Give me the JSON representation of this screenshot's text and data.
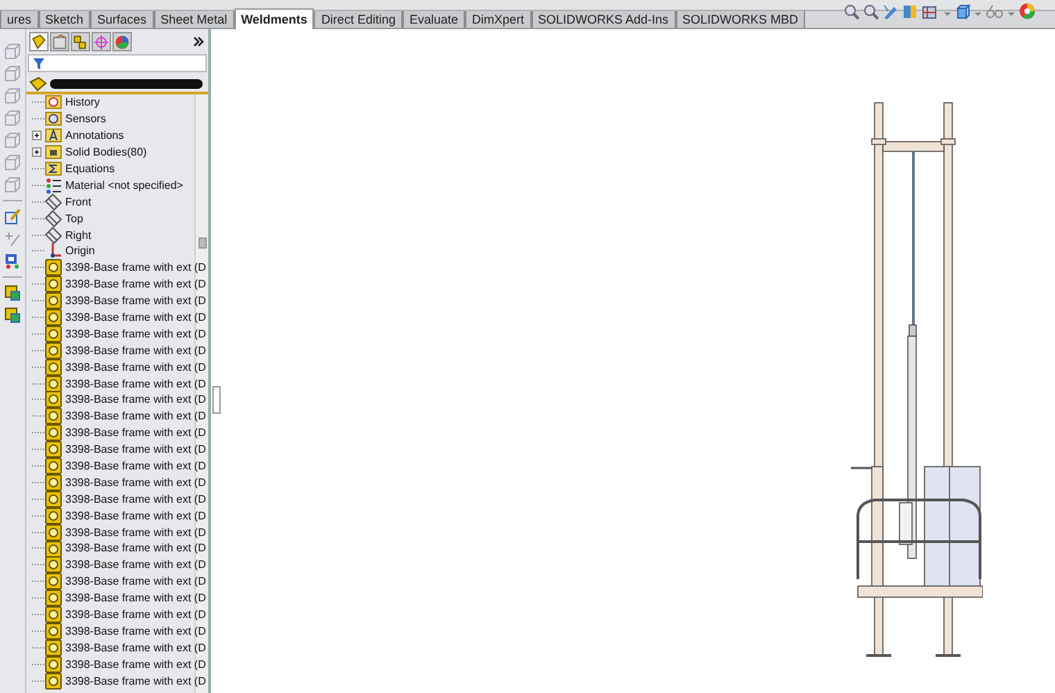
{
  "tabs": [
    {
      "label": "ures",
      "selected": false
    },
    {
      "label": "Sketch",
      "selected": false
    },
    {
      "label": "Surfaces",
      "selected": false
    },
    {
      "label": "Sheet Metal",
      "selected": false
    },
    {
      "label": "Weldments",
      "selected": true
    },
    {
      "label": "Direct Editing",
      "selected": false
    },
    {
      "label": "Evaluate",
      "selected": false
    },
    {
      "label": "DimXpert",
      "selected": false
    },
    {
      "label": "SOLIDWORKS Add-Ins",
      "selected": false
    },
    {
      "label": "SOLIDWORKS MBD",
      "selected": false
    }
  ],
  "panel_tabs": [
    {
      "kind": "tree",
      "selected": true
    },
    {
      "kind": "property",
      "selected": false
    },
    {
      "kind": "config",
      "selected": false
    },
    {
      "kind": "dim",
      "selected": false
    },
    {
      "kind": "display",
      "selected": false
    }
  ],
  "tree": {
    "items": [
      {
        "kind": "history",
        "label": "History",
        "expandable": false
      },
      {
        "kind": "sensors",
        "label": "Sensors",
        "expandable": false
      },
      {
        "kind": "annotations",
        "label": "Annotations",
        "expandable": true
      },
      {
        "kind": "bodies",
        "label": "Solid Bodies(80)",
        "expandable": true
      },
      {
        "kind": "equations",
        "label": "Equations",
        "expandable": false
      },
      {
        "kind": "material",
        "label": "Material <not specified>",
        "expandable": false
      },
      {
        "kind": "plane",
        "label": "Front",
        "expandable": false
      },
      {
        "kind": "plane",
        "label": "Top",
        "expandable": false
      },
      {
        "kind": "plane",
        "label": "Right",
        "expandable": false
      },
      {
        "kind": "origin",
        "label": "Origin",
        "expandable": false
      },
      {
        "kind": "part",
        "label": "3398-Base frame with ext (D",
        "expandable": false
      },
      {
        "kind": "part",
        "label": "3398-Base frame with ext (D",
        "expandable": false
      },
      {
        "kind": "part",
        "label": "3398-Base frame with ext (D",
        "expandable": false
      },
      {
        "kind": "part",
        "label": "3398-Base frame with ext (D",
        "expandable": false
      },
      {
        "kind": "part",
        "label": "3398-Base frame with ext (D",
        "expandable": false
      },
      {
        "kind": "part",
        "label": "3398-Base frame with ext (D",
        "expandable": false
      },
      {
        "kind": "part",
        "label": "3398-Base frame with ext (D",
        "expandable": false
      },
      {
        "kind": "part",
        "label": "3398-Base frame with ext (D",
        "expandable": false
      },
      {
        "kind": "part",
        "label": "3398-Base frame with ext (D",
        "expandable": false
      },
      {
        "kind": "part",
        "label": "3398-Base frame with ext (D",
        "expandable": false
      },
      {
        "kind": "part",
        "label": "3398-Base frame with ext (D",
        "expandable": false
      },
      {
        "kind": "part",
        "label": "3398-Base frame with ext (D",
        "expandable": false
      },
      {
        "kind": "part",
        "label": "3398-Base frame with ext (D",
        "expandable": false
      },
      {
        "kind": "part",
        "label": "3398-Base frame with ext (D",
        "expandable": false
      },
      {
        "kind": "part",
        "label": "3398-Base frame with ext (D",
        "expandable": false
      },
      {
        "kind": "part",
        "label": "3398-Base frame with ext (D",
        "expandable": false
      },
      {
        "kind": "part",
        "label": "3398-Base frame with ext (D",
        "expandable": false
      },
      {
        "kind": "part",
        "label": "3398-Base frame with ext (D",
        "expandable": false
      },
      {
        "kind": "part",
        "label": "3398-Base frame with ext (D",
        "expandable": false
      },
      {
        "kind": "part",
        "label": "3398-Base frame with ext (D",
        "expandable": false
      },
      {
        "kind": "part",
        "label": "3398-Base frame with ext (D",
        "expandable": false
      },
      {
        "kind": "part",
        "label": "3398-Base frame with ext (D",
        "expandable": false
      },
      {
        "kind": "part",
        "label": "3398-Base frame with ext (D",
        "expandable": false
      },
      {
        "kind": "part",
        "label": "3398-Base frame with ext (D",
        "expandable": false
      },
      {
        "kind": "part",
        "label": "3398-Base frame with ext (D",
        "expandable": false
      },
      {
        "kind": "part",
        "label": "3398-Base frame with ext (D",
        "expandable": false
      }
    ]
  }
}
